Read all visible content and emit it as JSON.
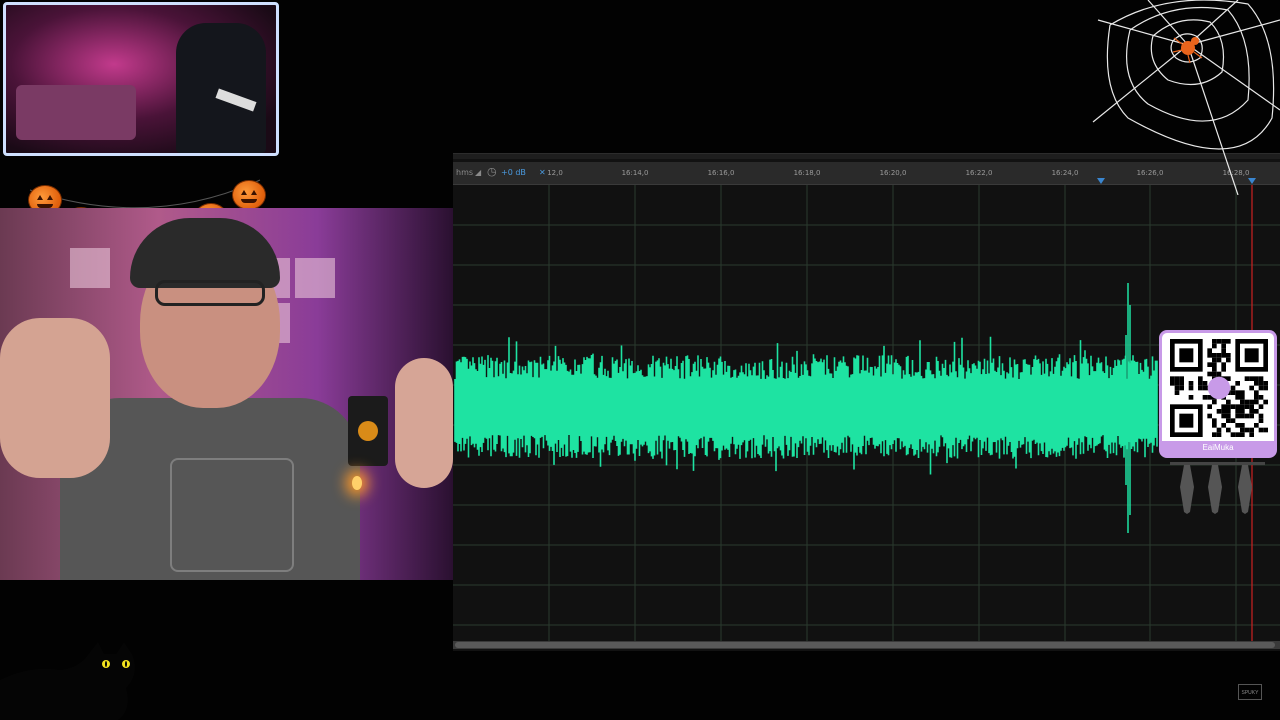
{
  "overlay": {
    "qr_label": "EaiMuka",
    "watermark": "SPUKY"
  },
  "editor": {
    "controls": {
      "hms_label": "hms",
      "gain_label": "+0 dB"
    },
    "ruler": {
      "ticks": [
        "12,0",
        "16:14,0",
        "16:16,0",
        "16:18,0",
        "16:20,0",
        "16:22,0",
        "16:24,0",
        "16:26,0",
        "16:28,0"
      ]
    },
    "colors": {
      "waveform": "#1ee3a2",
      "playhead": "#cc2222",
      "marker": "#3a86d0",
      "grid": "#2a3a2e"
    }
  },
  "colors": {
    "qr_accent": "#c89ae8",
    "pumpkin": "#f07418"
  },
  "icons": [
    "spider-web-icon",
    "spider-icon",
    "pumpkin-icon",
    "black-cat-icon",
    "bat-icon",
    "qr-code-icon"
  ]
}
